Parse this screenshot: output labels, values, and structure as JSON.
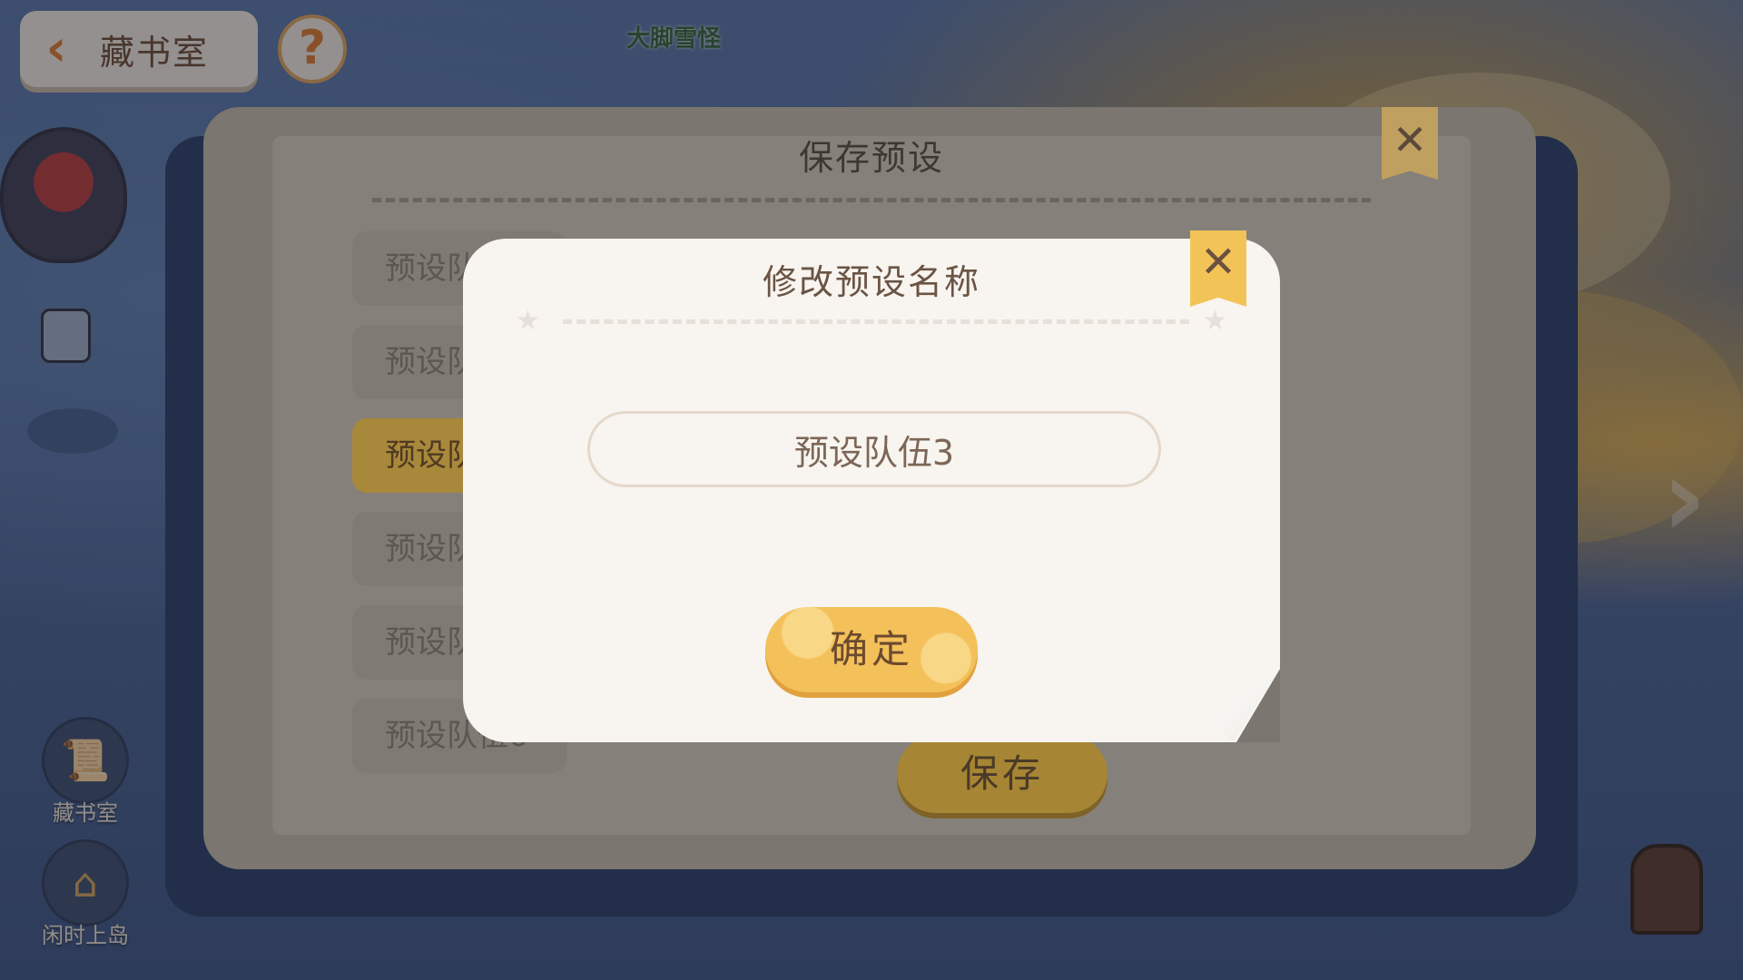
{
  "scene": {
    "npc_name": "大脚雪怪"
  },
  "nav": {
    "back_label": "藏书室",
    "help_symbol": "?"
  },
  "side_buttons": [
    {
      "label": "藏书室",
      "icon": "scroll-icon"
    },
    {
      "label": "闲时上岛",
      "icon": "island-house-icon"
    }
  ],
  "panel": {
    "title": "保存预设",
    "presets": [
      {
        "label": "预设队伍1",
        "active": false
      },
      {
        "label": "预设队伍2",
        "active": false
      },
      {
        "label": "预设队伍3",
        "active": true
      },
      {
        "label": "预设队伍4",
        "active": false
      },
      {
        "label": "预设队伍5",
        "active": false
      },
      {
        "label": "预设队伍6",
        "active": false
      }
    ],
    "save_label": "保存"
  },
  "modal": {
    "title": "修改预设名称",
    "close_symbol": "✕",
    "input_value": "预设队伍3",
    "confirm_label": "确定"
  },
  "colors": {
    "accent_yellow": "#f3c05a",
    "modal_bg": "#f8f4ef",
    "text_brown": "#6a5444"
  }
}
